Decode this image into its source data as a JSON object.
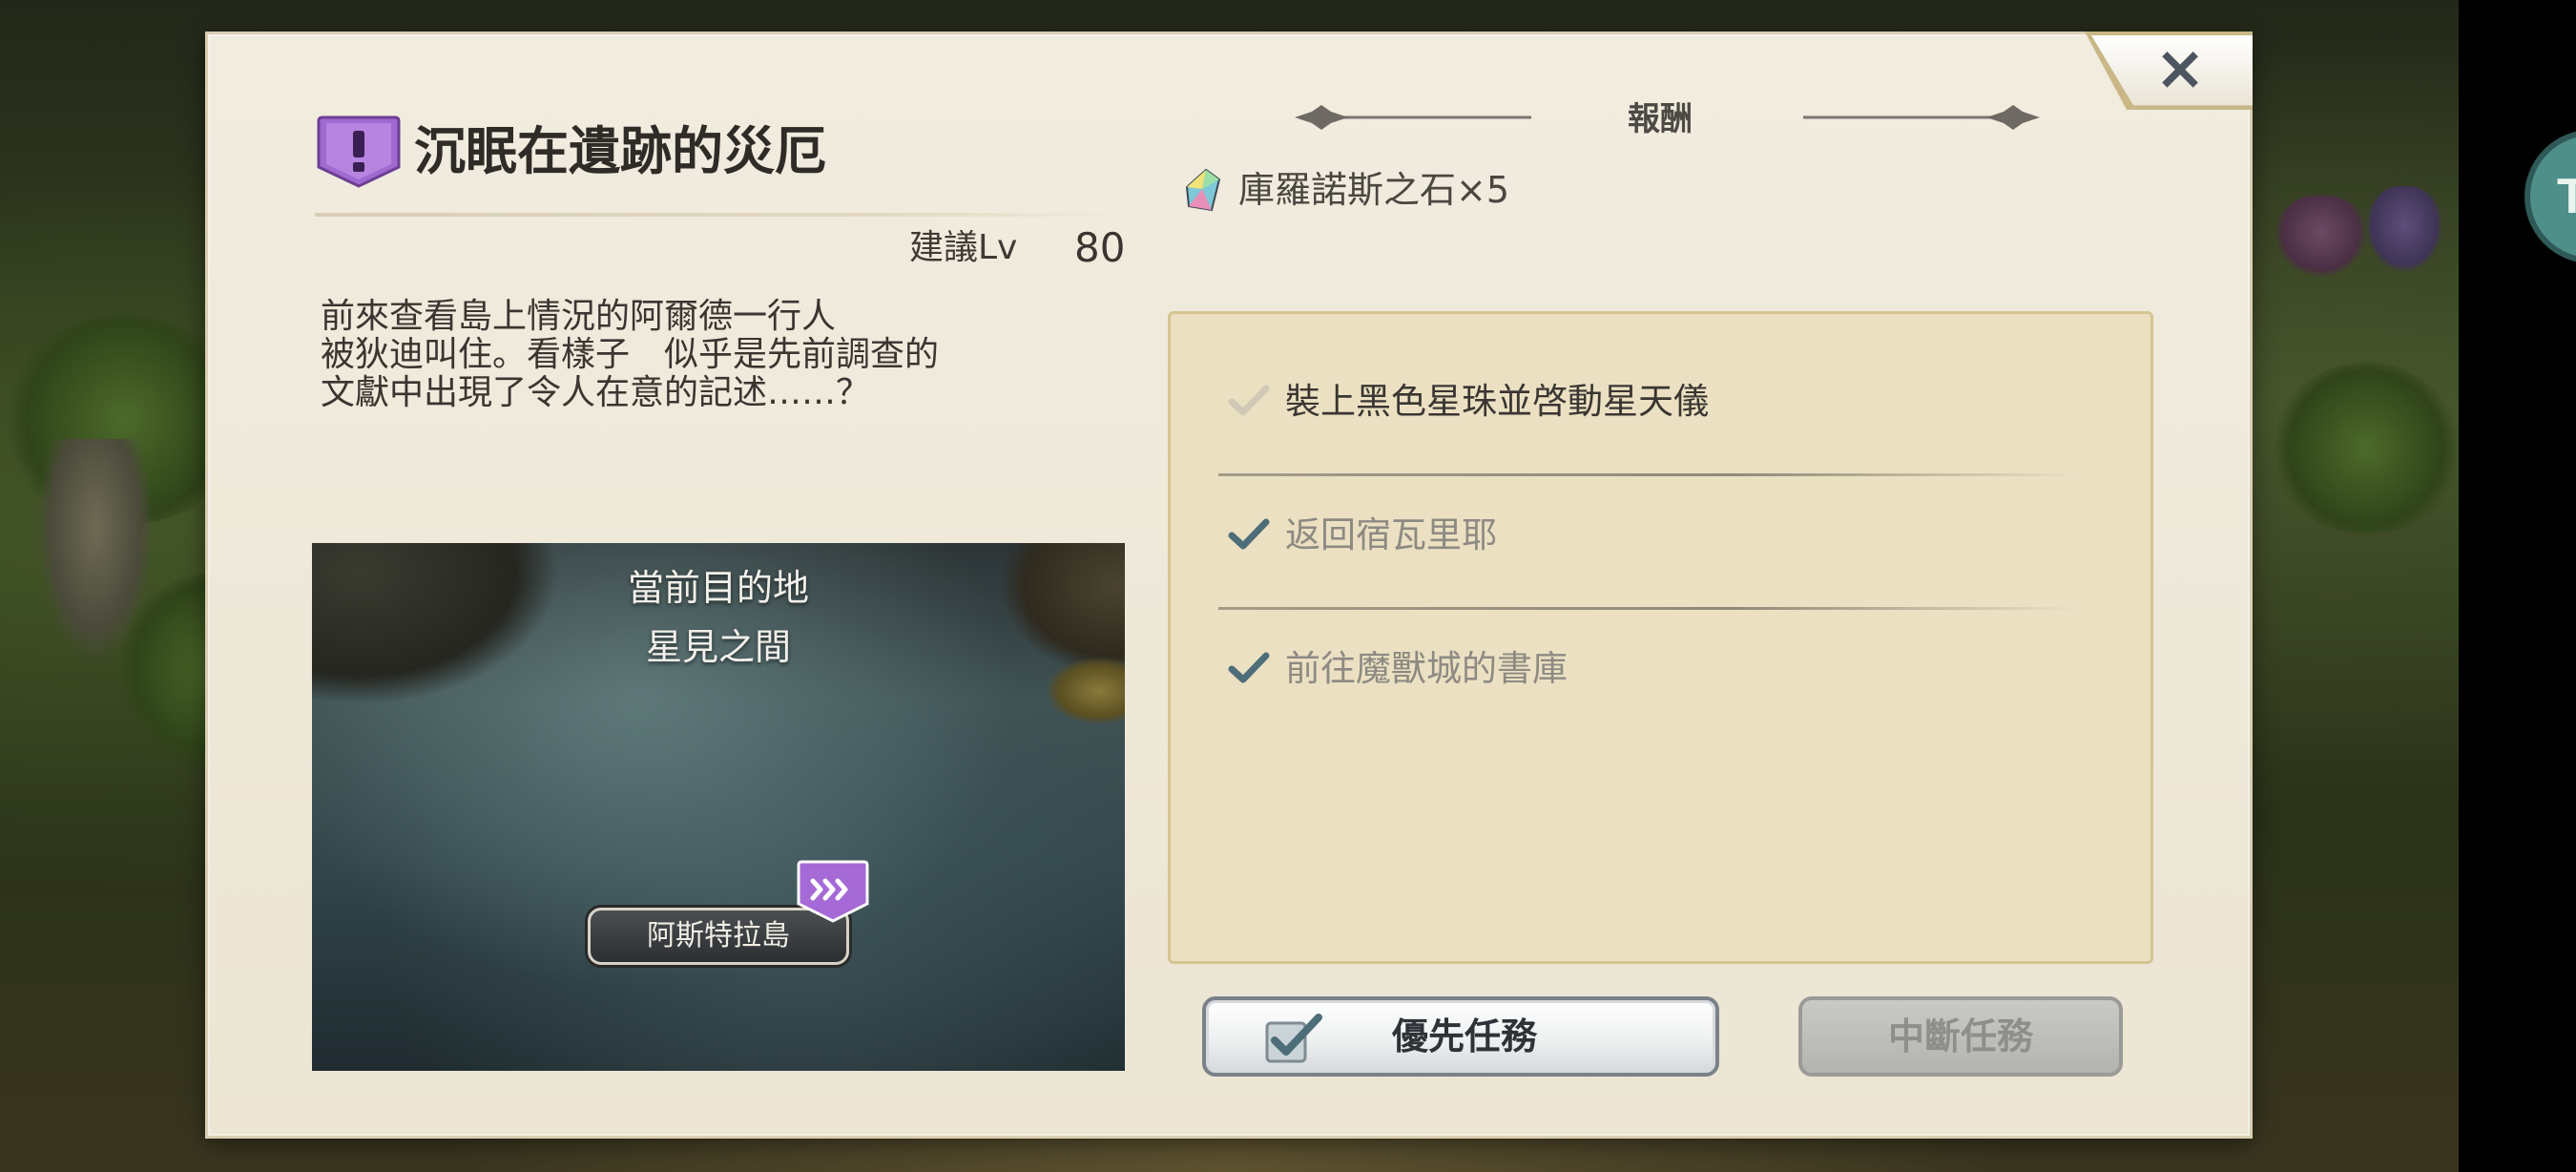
{
  "quest": {
    "title": "沉眠在遺跡的災厄",
    "level_label": "建議Lv",
    "level_value": "80",
    "description": "前來查看島上情況的阿爾德一行人\n被狄迪叫住。看樣子　似乎是先前調查的\n文獻中出現了令人在意的記述……？",
    "icon": "exclamation-shield-icon"
  },
  "map": {
    "heading": "當前目的地",
    "destination": "星見之間",
    "location_label": "阿斯特拉島"
  },
  "reward": {
    "title": "報酬",
    "item": "庫羅諾斯之石×5",
    "icon": "rainbow-crystal-icon"
  },
  "objectives": [
    {
      "text": "裝上黑色星珠並啓動星天儀",
      "status": "current"
    },
    {
      "text": "返回宿瓦里耶",
      "status": "done"
    },
    {
      "text": "前往魔獸城的書庫",
      "status": "done"
    }
  ],
  "buttons": {
    "priority": "優先任務",
    "abort": "中斷任務",
    "close": "×"
  },
  "side_badge": "T",
  "colors": {
    "accent_purple": "#a66bd6",
    "check_done": "#4d6d78",
    "check_current": "#cfc9b5",
    "text_done": "#8d8a82",
    "text_current": "#3a3632"
  }
}
